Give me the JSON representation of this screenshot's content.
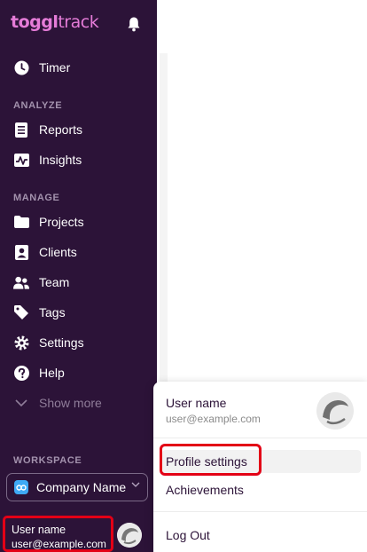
{
  "app": {
    "brand": "toggl",
    "product": "track"
  },
  "sidebar": {
    "timer": "Timer",
    "analyze_label": "ANALYZE",
    "analyze": [
      "Reports",
      "Insights"
    ],
    "manage_label": "MANAGE",
    "manage": [
      "Projects",
      "Clients",
      "Team",
      "Tags",
      "Settings",
      "Help"
    ],
    "show_more": "Show more",
    "workspace_label": "WORKSPACE",
    "workspace_name": "Company Name"
  },
  "user": {
    "name": "User name",
    "email": "user@example.com"
  },
  "profile_menu": {
    "name": "User name",
    "email": "user@example.com",
    "items": [
      "Profile settings",
      "Achievements",
      "Log Out"
    ]
  },
  "colors": {
    "sidebar_bg": "#2c1338",
    "logo": "#e57cd8",
    "highlight_outline": "#e30016"
  }
}
